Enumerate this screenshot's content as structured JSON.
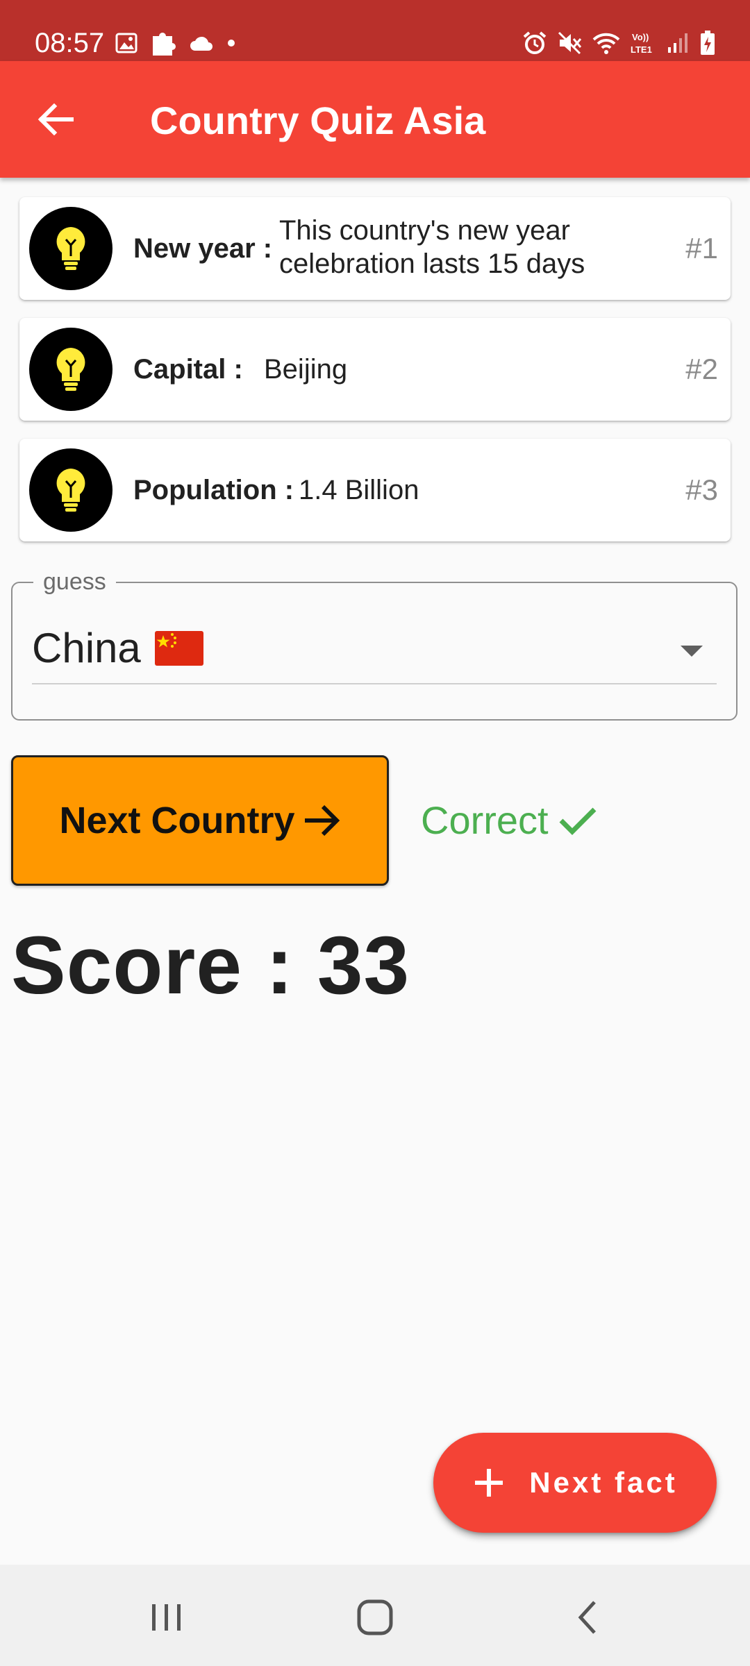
{
  "status_bar": {
    "time": "08:57"
  },
  "app_bar": {
    "title": "Country Quiz Asia",
    "back_icon": "arrow-back-icon"
  },
  "facts": [
    {
      "label": "New year :",
      "value_line1": "This country's new year",
      "value_line2": "celebration lasts 15 days",
      "number": "#1",
      "icon": "lightbulb-icon"
    },
    {
      "label": "Capital :",
      "value": "Beijing",
      "number": "#2",
      "icon": "lightbulb-icon"
    },
    {
      "label": "Population :",
      "value": "1.4 Billion",
      "number": "#3",
      "icon": "lightbulb-icon"
    }
  ],
  "guess": {
    "legend": "guess",
    "selected": "China"
  },
  "next_country": {
    "label": "Next Country"
  },
  "result": {
    "label": "Correct",
    "color": "#4caf50"
  },
  "score": {
    "text": "Score : 33"
  },
  "fab": {
    "label": "Next fact"
  },
  "colors": {
    "primary": "#f44336",
    "status_bar": "#b9302b",
    "accent_button": "#ff9800"
  }
}
